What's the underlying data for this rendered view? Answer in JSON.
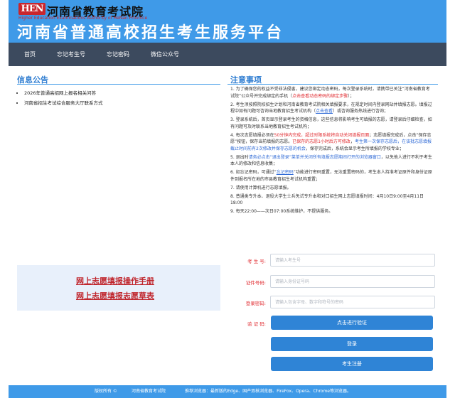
{
  "header": {
    "logo_mark": "HEN",
    "org_name": "河南省教育考试院",
    "org_name_en": "Higher Education Examinations Authority of HeNan Province",
    "site_title": "河南省普通高校招生考生服务平台"
  },
  "nav": {
    "items": [
      "首页",
      "忘记考生号",
      "忘记密码",
      "微信公众号"
    ]
  },
  "announcements": {
    "title": "信息公告",
    "items": [
      "2026年普通高招网上报名相关问答",
      "河南省招生考试综合服务大厅联系方式"
    ]
  },
  "manual": {
    "links": [
      "网上志愿填报操作手册",
      "网上志愿填报志愿草表"
    ]
  },
  "notice": {
    "title": "注意事项",
    "items": [
      [
        "1. 为了确保您的权益不受非法侵害，建议您绑定动态密码，每次登录系统时，请携带已关注“河南省教育考试院”公众号并完成绑定的手机（",
        "点击查看动态密码的绑定步骤",
        "）；"
      ],
      [
        "2. 考生须按照院校招生计划和河南省教育考试院相关填报要求，在规定时间内登录网站并填报志愿。填报过程中如有问题可咨询当地教育招生考试机构（",
        "点击查看",
        "）或咨询服务热线进行咨询；"
      ],
      [
        "3. 登录系统后，首页显示登录考生的资格信息，这些信息将影响考生可填报的志愿，请登录后仔细检查，如有问题可及时联系当地教育招生考试机构；"
      ],
      [
        "4. 每次志愿填报必须在",
        "50分钟内完成，超过时限系统将自动关闭填报页面",
        "；志愿填报完成后，点击“保存志愿”按钮，保存当前填报的志愿。",
        "已保存的志愿1小时后方可修改",
        "，",
        "考生第一次保存志愿后，在该批志愿填报截止时间前有2次修改并保存志愿的机会",
        "，保存完成后，系统会显示考生所填报的学校专业；"
      ],
      [
        "5. 退出时",
        "请务必点击“退出登录”菜单并关闭所有填报志愿期间打开的浏览器窗口",
        "，以免他人进行不利于考生本人的修改和信息收集；"
      ],
      [
        "6. 如忘记密码，可通过“",
        "忘记密码",
        "”功能进行密码重置，无法重置密码的，考生本人持准考证原件和身份证原件到报名所在地的市县教育招生考试机构重置；"
      ],
      [
        "7. 请使用计算机进行志愿填报。"
      ],
      [
        "8. 普通类专升本、退役大学生士兵免试专升本和对口招生网上志愿填报时间：4月10日9:00至4月11日18:00"
      ],
      [
        "9. 每天22:00——次日07:00系统维护，不提供服务。"
      ]
    ]
  },
  "login_form": {
    "fields": [
      {
        "label": "考 生 号:",
        "placeholder": "请输入考生号"
      },
      {
        "label": "证件号码:",
        "placeholder": "请输入身份证号码"
      },
      {
        "label": "登录密码:",
        "placeholder": "请输入包含字母、数字和符号的密码"
      }
    ],
    "verify_label": "验 证 码:",
    "verify_button": "点击进行验证",
    "login_button": "登录",
    "register_button": "考生注册"
  },
  "footer": {
    "copyright": "版权所有 ©",
    "org": "河南省教育考试院",
    "browser_tip": "推荐浏览器：最新版的Edge、国产双核浏览器、FireFox、Opera、Chrome等浏览器。"
  },
  "colors": {
    "primary": "#3f9ae8",
    "nav_bg": "#3c4a5e",
    "accent_red": "#c0262d",
    "button": "#2f84d6"
  }
}
